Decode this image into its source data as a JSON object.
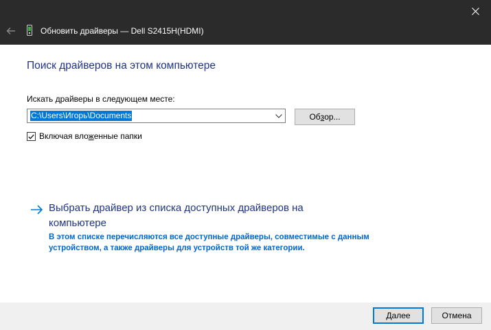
{
  "window": {
    "title": "Обновить драйверы — Dell S2415H(HDMI)"
  },
  "main": {
    "heading": "Поиск драйверов на этом компьютере",
    "search_label": "Искать драйверы в следующем месте:",
    "path_value": "C:\\Users\\Игорь\\Documents",
    "browse_pre": "Об",
    "browse_u": "з",
    "browse_post": "ор...",
    "include_pre": "Включая вло",
    "include_u": "ж",
    "include_post": "енные папки",
    "include_checked": true,
    "link_title": "Выбрать драйвер из списка доступных драйверов на компьютере",
    "link_description": "В этом списке перечисляются все доступные драйверы, совместимые с данным устройством, а также драйверы для устройств той же категории."
  },
  "footer": {
    "next_u": "Д",
    "next_rest": "алее",
    "cancel_label": "Отмена"
  },
  "colors": {
    "titlebar": "#2b2b2b",
    "heading": "#1e3287",
    "link_desc": "#0066cc",
    "accent": "#0078d7"
  },
  "icons": {
    "close": "close-icon",
    "back": "back-arrow-icon",
    "device": "device-icon",
    "dropdown": "chevron-down-icon",
    "link_arrow": "arrow-right-icon",
    "check": "checkmark-icon"
  }
}
